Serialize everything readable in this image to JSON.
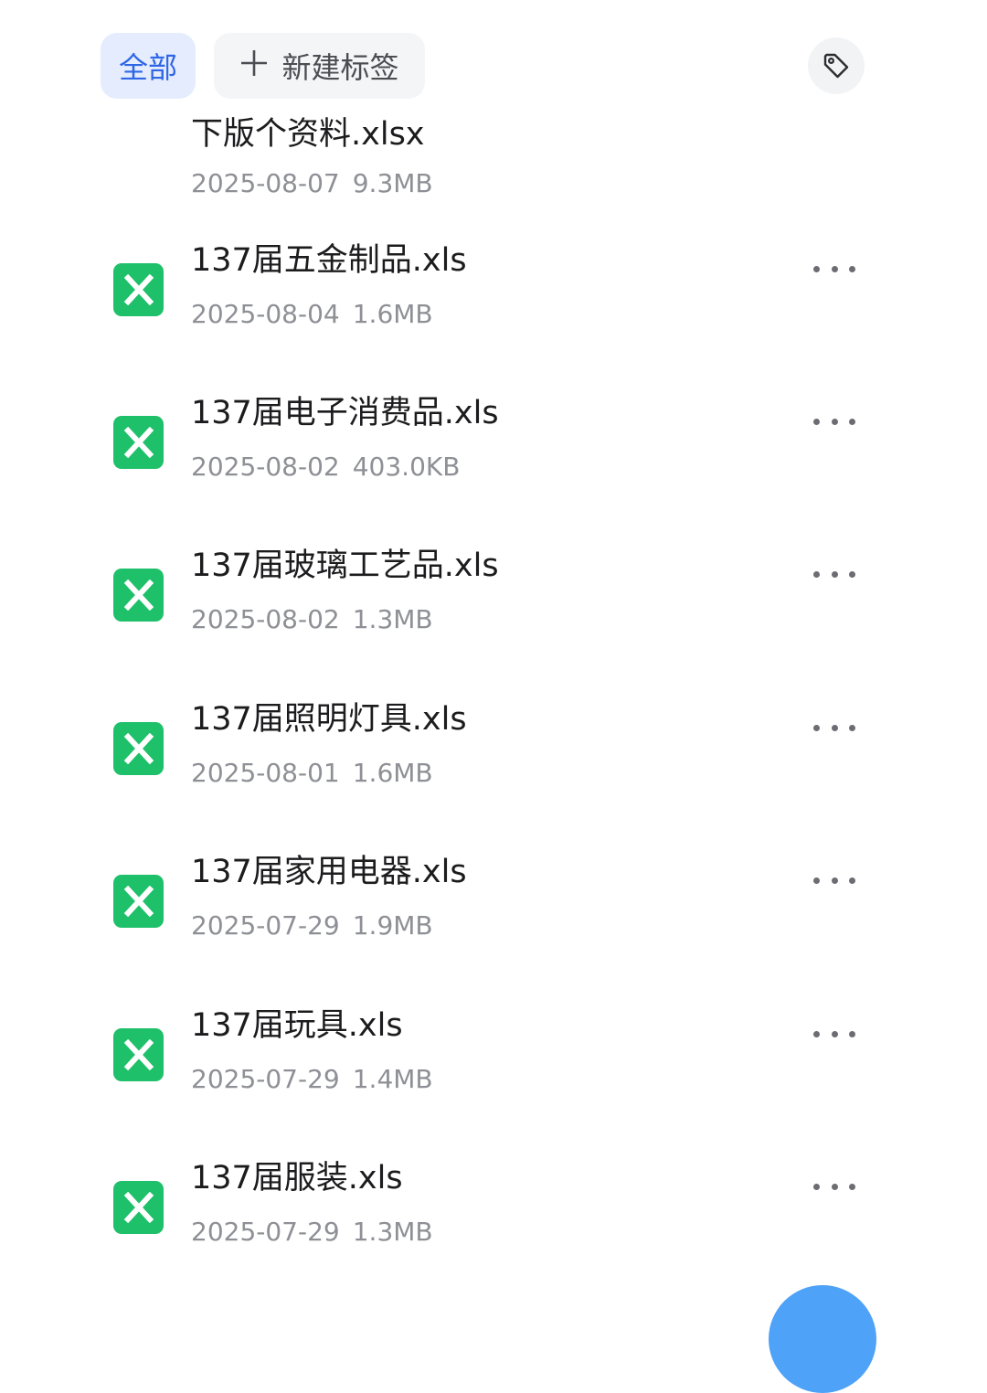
{
  "filters": {
    "all_label": "全部",
    "new_tag_label": "新建标签"
  },
  "files": [
    {
      "name": "下版个资料.xlsx",
      "date": "2025-08-07",
      "size": "9.3MB"
    },
    {
      "name": "137届五金制品.xls",
      "date": "2025-08-04",
      "size": "1.6MB"
    },
    {
      "name": "137届电子消费品.xls",
      "date": "2025-08-02",
      "size": "403.0KB"
    },
    {
      "name": "137届玻璃工艺品.xls",
      "date": "2025-08-02",
      "size": "1.3MB"
    },
    {
      "name": "137届照明灯具.xls",
      "date": "2025-08-01",
      "size": "1.6MB"
    },
    {
      "name": "137届家用电器.xls",
      "date": "2025-07-29",
      "size": "1.9MB"
    },
    {
      "name": "137届玩具.xls",
      "date": "2025-07-29",
      "size": "1.4MB"
    },
    {
      "name": "137届服装.xls",
      "date": "2025-07-29",
      "size": "1.3MB"
    }
  ],
  "colors": {
    "accent": "#2f66e6",
    "excel_green": "#1ec06a",
    "fab": "#4ea2f7"
  },
  "icons": {
    "file": "excel-file-icon",
    "more": "more-horizontal-icon",
    "tag": "tag-icon",
    "plus": "plus-icon"
  }
}
